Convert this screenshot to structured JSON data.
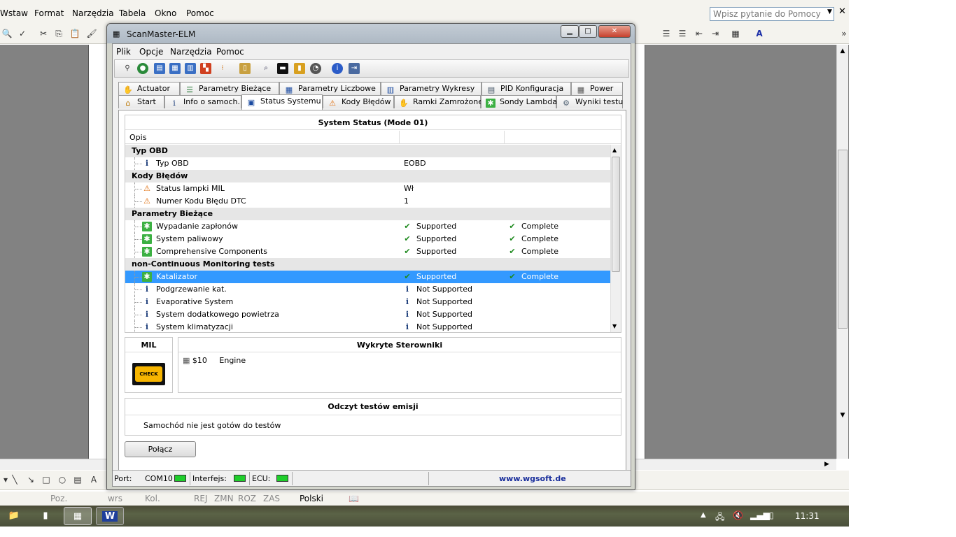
{
  "word": {
    "menu": [
      "Wstaw",
      "Format",
      "Narzędzia",
      "Tabela",
      "Okno",
      "Pomoc"
    ],
    "help_placeholder": "Wpisz pytanie do Pomocy",
    "status": {
      "poz": "Poz.",
      "wrs": "wrs",
      "kol": "Kol.",
      "rej": "REJ",
      "zmn": "ZMN",
      "roz": "ROZ",
      "zas": "ZAS",
      "lang": "Polski"
    }
  },
  "taskbar": {
    "clock": "11:31"
  },
  "scanmaster": {
    "title": "ScanMaster-ELM",
    "menu": [
      "Plik",
      "Opcje",
      "Narzędzia",
      "Pomoc"
    ],
    "tabs_row1": [
      "Actuator",
      "Parametry Bieżące",
      "Parametry Liczbowe",
      "Parametry Wykresy",
      "PID Konfiguracja",
      "Power"
    ],
    "tabs_row2": [
      "Start",
      "Info o samoch.",
      "Status Systemu",
      "Kody Błędów",
      "Ramki Zamrożone",
      "Sondy Lambda",
      "Wyniki testu"
    ],
    "status_panel": {
      "title": "System Status (Mode 01)",
      "column_opis": "Opis",
      "rows": [
        {
          "type": "group",
          "label": "Typ OBD"
        },
        {
          "type": "item",
          "icon": "info",
          "label": "Typ OBD",
          "value": "EOBD"
        },
        {
          "type": "group",
          "label": "Kody Błędów"
        },
        {
          "type": "item",
          "icon": "warn",
          "label": "Status lampki MIL",
          "value": "Wł"
        },
        {
          "type": "item",
          "icon": "warn",
          "label": "Numer Kodu Błędu DTC",
          "value": "1"
        },
        {
          "type": "group",
          "label": "Parametry Bieżące"
        },
        {
          "type": "test",
          "label": "Wypadanie zapłonów",
          "avail": "Supported",
          "state": "Complete"
        },
        {
          "type": "test",
          "label": "System paliwowy",
          "avail": "Supported",
          "state": "Complete"
        },
        {
          "type": "test",
          "label": "Comprehensive Components",
          "avail": "Supported",
          "state": "Complete"
        },
        {
          "type": "group",
          "label": "non-Continuous Monitoring tests"
        },
        {
          "type": "test",
          "label": "Katalizator",
          "avail": "Supported",
          "state": "Complete",
          "selected": true
        },
        {
          "type": "ns",
          "label": "Podgrzewanie kat.",
          "avail": "Not Supported"
        },
        {
          "type": "ns",
          "label": "Evaporative System",
          "avail": "Not Supported"
        },
        {
          "type": "ns",
          "label": "System dodatkowego powietrza",
          "avail": "Not Supported"
        },
        {
          "type": "ns",
          "label": "System klimatyzacji",
          "avail": "Not Supported"
        }
      ]
    },
    "mil": {
      "title": "MIL",
      "lamp_text": "CHECK"
    },
    "ecu": {
      "title": "Wykryte Sterowniki",
      "addr": "$10",
      "name": "Engine"
    },
    "emission": {
      "title": "Odczyt testów emisji",
      "text": "Samochód nie jest gotów do testów"
    },
    "connect_label": "Połącz",
    "statusbar": {
      "port_label": "Port:",
      "port": "COM10",
      "iface_label": "Interfejs:",
      "ecu_label": "ECU:",
      "url": "www.wgsoft.de"
    }
  }
}
